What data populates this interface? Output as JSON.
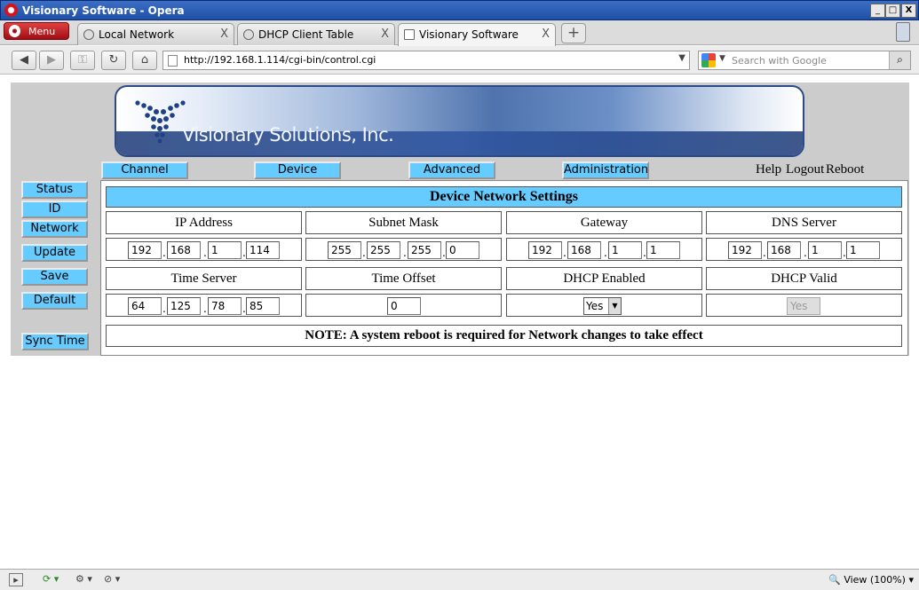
{
  "window": {
    "title": "Visionary Software - Opera",
    "minimize": "_",
    "maximize": "□",
    "close": "X"
  },
  "browser": {
    "menu_label": "Menu",
    "tabs": [
      {
        "label": "Local Network",
        "close": "X"
      },
      {
        "label": "DHCP Client Table",
        "close": "X"
      },
      {
        "label": "Visionary Software",
        "close": "X"
      }
    ],
    "new_tab": "+",
    "url": "http://192.168.1.114/cgi-bin/control.cgi",
    "search_placeholder": "Search with Google",
    "zoom": "View (100%)"
  },
  "page": {
    "company": "Visionary Solutions, Inc.",
    "nav_tabs": [
      "Channel",
      "Device",
      "Advanced",
      "Administration"
    ],
    "header_links": [
      "Help",
      "Logout",
      "Reboot"
    ],
    "side_buttons": [
      "Status",
      "ID",
      "Network",
      "Update",
      "Save",
      "Default",
      "Sync Time"
    ],
    "panel_title": "Device Network Settings",
    "fields": {
      "ip_address": {
        "label": "IP Address",
        "octets": [
          "192",
          "168",
          "1",
          "114"
        ]
      },
      "subnet_mask": {
        "label": "Subnet Mask",
        "octets": [
          "255",
          "255",
          "255",
          "0"
        ]
      },
      "gateway": {
        "label": "Gateway",
        "octets": [
          "192",
          "168",
          "1",
          "1"
        ]
      },
      "dns_server": {
        "label": "DNS Server",
        "octets": [
          "192",
          "168",
          "1",
          "1"
        ]
      },
      "time_server": {
        "label": "Time Server",
        "octets": [
          "64",
          "125",
          "78",
          "85"
        ]
      },
      "time_offset": {
        "label": "Time Offset",
        "value": "0"
      },
      "dhcp_enabled": {
        "label": "DHCP Enabled",
        "value": "Yes"
      },
      "dhcp_valid": {
        "label": "DHCP Valid",
        "value": "Yes"
      }
    },
    "note": "NOTE: A system reboot is required for Network changes to take effect"
  },
  "colors": {
    "accent": "#66ccff",
    "page_bg": "#cccccc"
  }
}
